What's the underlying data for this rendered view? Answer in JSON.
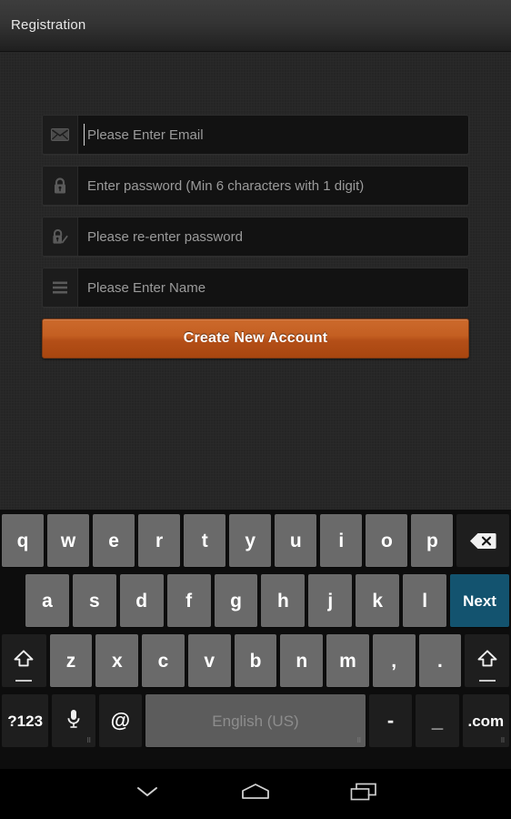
{
  "titlebar": {
    "title": "Registration"
  },
  "form": {
    "fields": [
      {
        "icon": "envelope-icon",
        "name": "email-field",
        "placeholder": "Please Enter Email",
        "focused": true
      },
      {
        "icon": "lock-icon",
        "name": "password-field",
        "placeholder": "Enter password (Min 6 characters with 1 digit)",
        "focused": false
      },
      {
        "icon": "lock-edit-icon",
        "name": "confirm-password-field",
        "placeholder": "Please re-enter password",
        "focused": false
      },
      {
        "icon": "list-lines-icon",
        "name": "name-field",
        "placeholder": "Please Enter Name",
        "focused": false
      }
    ],
    "submit_label": "Create New Account"
  },
  "keyboard": {
    "language": "English (US)",
    "row1": [
      "q",
      "w",
      "e",
      "r",
      "t",
      "y",
      "u",
      "i",
      "o",
      "p"
    ],
    "row2": [
      "a",
      "s",
      "d",
      "f",
      "g",
      "h",
      "j",
      "k",
      "l"
    ],
    "row3": [
      "z",
      "x",
      "c",
      "v",
      "b",
      "n",
      "m",
      ",",
      "."
    ],
    "backspace_label": "backspace-icon",
    "enter_label": "Next",
    "shift_label": "shift-icon",
    "symbols_label": "?123",
    "mic_label": "microphone-icon",
    "at_label": "@",
    "hyphen_label": "-",
    "underscore_label": "_",
    "dotcom_label": ".com",
    "hint_dots": "⠿"
  },
  "navbar": {
    "back_label": "hide-keyboard-icon",
    "home_label": "home-icon",
    "recents_label": "recent-apps-icon"
  },
  "colors": {
    "background": "#252525",
    "titlebar": "#343434",
    "accent_button": "#c45f22",
    "key": "#6a6a6a",
    "key_dark": "#1e1e1e",
    "enter_key": "#13536f",
    "spacebar": "#5c5c5c"
  }
}
